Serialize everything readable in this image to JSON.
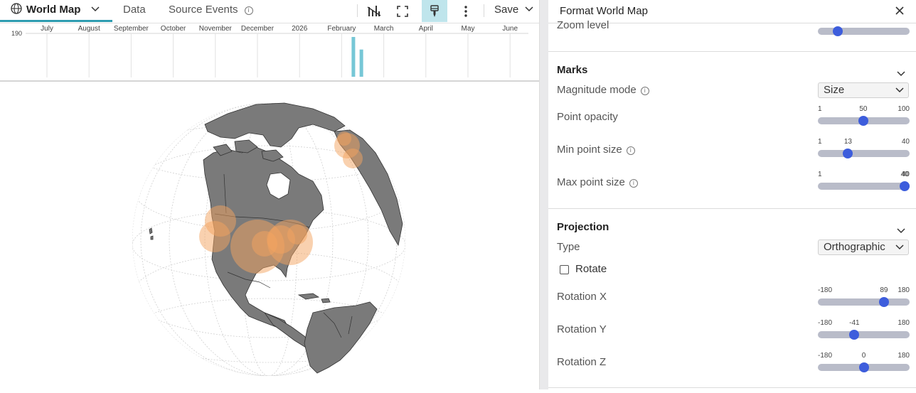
{
  "toolbar": {
    "tab_world_map": "World Map",
    "tab_data": "Data",
    "tab_source_events": "Source Events",
    "save_label": "Save"
  },
  "timeline": {
    "y_tick": "190",
    "months": [
      "July",
      "August",
      "September",
      "October",
      "November",
      "December",
      "2026",
      "February",
      "March",
      "April",
      "May",
      "June"
    ],
    "bars": [
      {
        "month_index": 7,
        "value": 190
      },
      {
        "month_index": 7.2,
        "value": 130
      }
    ]
  },
  "panel": {
    "title": "Format World Map",
    "zoom_level_label": "Zoom level",
    "zoom_level_fraction": 0.18,
    "marks": {
      "title": "Marks",
      "magnitude_mode_label": "Magnitude mode",
      "magnitude_mode_value": "Size",
      "point_opacity": {
        "label": "Point opacity",
        "min": "1",
        "value": "50",
        "max": "100"
      },
      "min_point_size": {
        "label": "Min point size",
        "min": "1",
        "value": "13",
        "max": "40"
      },
      "max_point_size": {
        "label": "Max point size",
        "min": "1",
        "value": "40",
        "max": "40"
      }
    },
    "projection": {
      "title": "Projection",
      "type_label": "Type",
      "type_value": "Orthographic",
      "rotate_label": "Rotate",
      "rotation_x": {
        "label": "Rotation X",
        "min": "-180",
        "value": "89",
        "max": "180"
      },
      "rotation_y": {
        "label": "Rotation Y",
        "min": "-180",
        "value": "-41",
        "max": "180"
      },
      "rotation_z": {
        "label": "Rotation Z",
        "min": "-180",
        "value": "0",
        "max": "180"
      }
    }
  },
  "colors": {
    "accent": "#2e9cb0",
    "tab_highlight_bg": "#bfe5ec",
    "slider_thumb": "#3d5ddc",
    "land": "#7a7a7a",
    "marker": "#f4a460"
  }
}
